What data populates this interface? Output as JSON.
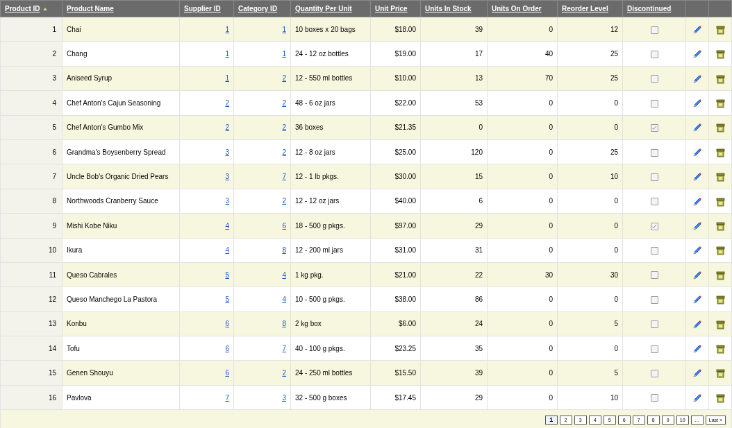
{
  "columns": [
    {
      "label": "Product ID",
      "sorted": true
    },
    {
      "label": "Product Name",
      "sorted": false
    },
    {
      "label": "Supplier ID",
      "sorted": false
    },
    {
      "label": "Category ID",
      "sorted": false
    },
    {
      "label": "Quantity Per Unit",
      "sorted": false
    },
    {
      "label": "Unit Price",
      "sorted": false
    },
    {
      "label": "Units In Stock",
      "sorted": false
    },
    {
      "label": "Units On Order",
      "sorted": false
    },
    {
      "label": "Reorder Level",
      "sorted": false
    },
    {
      "label": "Discontinued",
      "sorted": false
    }
  ],
  "rows": [
    {
      "id": "1",
      "name": "Chai",
      "supplier": "1",
      "category": "1",
      "qty": "10 boxes x 20 bags",
      "price": "$18.00",
      "stock": "39",
      "order": "0",
      "reorder": "12",
      "discontinued": false
    },
    {
      "id": "2",
      "name": "Chang",
      "supplier": "1",
      "category": "1",
      "qty": "24 - 12 oz bottles",
      "price": "$19.00",
      "stock": "17",
      "order": "40",
      "reorder": "25",
      "discontinued": false
    },
    {
      "id": "3",
      "name": "Aniseed Syrup",
      "supplier": "1",
      "category": "2",
      "qty": "12 - 550 ml bottles",
      "price": "$10.00",
      "stock": "13",
      "order": "70",
      "reorder": "25",
      "discontinued": false
    },
    {
      "id": "4",
      "name": "Chef Anton's Cajun Seasoning",
      "supplier": "2",
      "category": "2",
      "qty": "48 - 6 oz jars",
      "price": "$22.00",
      "stock": "53",
      "order": "0",
      "reorder": "0",
      "discontinued": false
    },
    {
      "id": "5",
      "name": "Chef Anton's Gumbo Mix",
      "supplier": "2",
      "category": "2",
      "qty": "36 boxes",
      "price": "$21.35",
      "stock": "0",
      "order": "0",
      "reorder": "0",
      "discontinued": true
    },
    {
      "id": "6",
      "name": "Grandma's Boysenberry Spread",
      "supplier": "3",
      "category": "2",
      "qty": "12 - 8 oz jars",
      "price": "$25.00",
      "stock": "120",
      "order": "0",
      "reorder": "25",
      "discontinued": false
    },
    {
      "id": "7",
      "name": "Uncle Bob's Organic Dried Pears",
      "supplier": "3",
      "category": "7",
      "qty": "12 - 1 lb pkgs.",
      "price": "$30.00",
      "stock": "15",
      "order": "0",
      "reorder": "10",
      "discontinued": false
    },
    {
      "id": "8",
      "name": "Northwoods Cranberry Sauce",
      "supplier": "3",
      "category": "2",
      "qty": "12 - 12 oz jars",
      "price": "$40.00",
      "stock": "6",
      "order": "0",
      "reorder": "0",
      "discontinued": false
    },
    {
      "id": "9",
      "name": "Mishi Kobe Niku",
      "supplier": "4",
      "category": "6",
      "qty": "18 - 500 g pkgs.",
      "price": "$97.00",
      "stock": "29",
      "order": "0",
      "reorder": "0",
      "discontinued": true
    },
    {
      "id": "10",
      "name": "Ikura",
      "supplier": "4",
      "category": "8",
      "qty": "12 - 200 ml jars",
      "price": "$31.00",
      "stock": "31",
      "order": "0",
      "reorder": "0",
      "discontinued": false
    },
    {
      "id": "11",
      "name": "Queso Cabrales",
      "supplier": "5",
      "category": "4",
      "qty": "1 kg pkg.",
      "price": "$21.00",
      "stock": "22",
      "order": "30",
      "reorder": "30",
      "discontinued": false
    },
    {
      "id": "12",
      "name": "Queso Manchego La Pastora",
      "supplier": "5",
      "category": "4",
      "qty": "10 - 500 g pkgs.",
      "price": "$38.00",
      "stock": "86",
      "order": "0",
      "reorder": "0",
      "discontinued": false
    },
    {
      "id": "13",
      "name": "Konbu",
      "supplier": "6",
      "category": "8",
      "qty": "2 kg box",
      "price": "$6.00",
      "stock": "24",
      "order": "0",
      "reorder": "5",
      "discontinued": false
    },
    {
      "id": "14",
      "name": "Tofu",
      "supplier": "6",
      "category": "7",
      "qty": "40 - 100 g pkgs.",
      "price": "$23.25",
      "stock": "35",
      "order": "0",
      "reorder": "0",
      "discontinued": false
    },
    {
      "id": "15",
      "name": "Genen Shouyu",
      "supplier": "6",
      "category": "2",
      "qty": "24 - 250 ml bottles",
      "price": "$15.50",
      "stock": "39",
      "order": "0",
      "reorder": "5",
      "discontinued": false
    },
    {
      "id": "16",
      "name": "Pavlova",
      "supplier": "7",
      "category": "3",
      "qty": "32 - 500 g boxes",
      "price": "$17.45",
      "stock": "29",
      "order": "0",
      "reorder": "10",
      "discontinued": false
    }
  ],
  "pager": [
    {
      "label": "1",
      "selected": true
    },
    {
      "label": "2",
      "selected": false
    },
    {
      "label": "3",
      "selected": false
    },
    {
      "label": "4",
      "selected": false
    },
    {
      "label": "5",
      "selected": false
    },
    {
      "label": "6",
      "selected": false
    },
    {
      "label": "7",
      "selected": false
    },
    {
      "label": "8",
      "selected": false
    },
    {
      "label": "9",
      "selected": false
    },
    {
      "label": "10",
      "selected": false
    },
    {
      "label": "...",
      "selected": false
    },
    {
      "label": "Last >",
      "selected": false
    }
  ]
}
